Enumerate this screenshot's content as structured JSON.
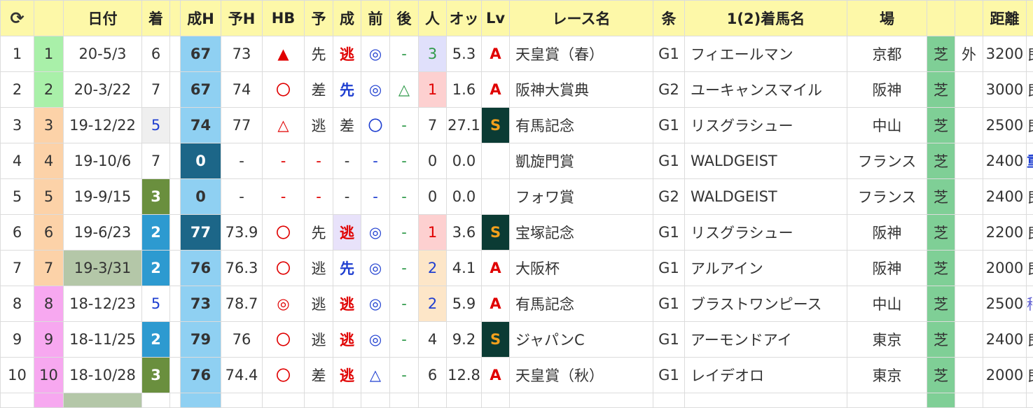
{
  "header": {
    "refresh_icon": "refresh-icon",
    "cols": [
      "",
      "日付",
      "着",
      "",
      "成H",
      "予H",
      "HB",
      "予",
      "成",
      "前",
      "後",
      "人",
      "オッ",
      "Lv",
      "レース名",
      "条",
      "1(2)着馬名",
      "場",
      "",
      "",
      "距離",
      ""
    ]
  },
  "rows": [
    {
      "idx": "1",
      "num": "1",
      "date": "20-5/3",
      "finish": "6",
      "seiH": "67",
      "yoH": "73",
      "hb": "▲",
      "yo": "先",
      "sei": "逃",
      "mae": "◎",
      "ato": "-",
      "pop": "3",
      "odds": "5.3",
      "lv": "A",
      "race": "天皇賞（春）",
      "cls": "G1",
      "horse": "フィエールマン",
      "venue": "京都",
      "surface": "芝",
      "course": "外",
      "dist": "3200",
      "going": "良"
    },
    {
      "idx": "2",
      "num": "2",
      "date": "20-3/22",
      "finish": "7",
      "seiH": "67",
      "yoH": "74",
      "hb": "〇",
      "yo": "差",
      "sei": "先",
      "mae": "◎",
      "ato": "△",
      "pop": "1",
      "odds": "1.6",
      "lv": "A",
      "race": "阪神大賞典",
      "cls": "G2",
      "horse": "ユーキャンスマイル",
      "venue": "阪神",
      "surface": "芝",
      "course": "",
      "dist": "3000",
      "going": "良"
    },
    {
      "idx": "3",
      "num": "3",
      "date": "19-12/22",
      "finish": "5",
      "seiH": "74",
      "yoH": "77",
      "hb": "△",
      "yo": "逃",
      "sei": "差",
      "mae": "〇",
      "ato": "-",
      "pop": "7",
      "odds": "27.1",
      "lv": "S",
      "race": "有馬記念",
      "cls": "G1",
      "horse": "リスグラシュー",
      "venue": "中山",
      "surface": "芝",
      "course": "",
      "dist": "2500",
      "going": "良"
    },
    {
      "idx": "4",
      "num": "4",
      "date": "19-10/6",
      "finish": "7",
      "seiH": "0",
      "yoH": "-",
      "hb": "-",
      "yo": "-",
      "sei": "-",
      "mae": "-",
      "ato": "-",
      "pop": "0",
      "odds": "0.0",
      "lv": "",
      "race": "凱旋門賞",
      "cls": "G1",
      "horse": "WALDGEIST",
      "venue": "フランス",
      "surface": "芝",
      "course": "",
      "dist": "2400",
      "going": "重"
    },
    {
      "idx": "5",
      "num": "5",
      "date": "19-9/15",
      "finish": "3",
      "seiH": "0",
      "yoH": "-",
      "hb": "-",
      "yo": "-",
      "sei": "-",
      "mae": "-",
      "ato": "-",
      "pop": "0",
      "odds": "0.0",
      "lv": "",
      "race": "フォワ賞",
      "cls": "G2",
      "horse": "WALDGEIST",
      "venue": "フランス",
      "surface": "芝",
      "course": "",
      "dist": "2400",
      "going": "良"
    },
    {
      "idx": "6",
      "num": "6",
      "date": "19-6/23",
      "finish": "2",
      "seiH": "77",
      "yoH": "73.9",
      "hb": "〇",
      "yo": "先",
      "sei": "逃",
      "mae": "◎",
      "ato": "-",
      "pop": "1",
      "odds": "3.6",
      "lv": "S",
      "race": "宝塚記念",
      "cls": "G1",
      "horse": "リスグラシュー",
      "venue": "阪神",
      "surface": "芝",
      "course": "",
      "dist": "2200",
      "going": "良"
    },
    {
      "idx": "7",
      "num": "7",
      "date": "19-3/31",
      "finish": "2",
      "seiH": "76",
      "yoH": "76.3",
      "hb": "〇",
      "yo": "逃",
      "sei": "先",
      "mae": "◎",
      "ato": "-",
      "pop": "2",
      "odds": "4.1",
      "lv": "A",
      "race": "大阪杯",
      "cls": "G1",
      "horse": "アルアイン",
      "venue": "阪神",
      "surface": "芝",
      "course": "",
      "dist": "2000",
      "going": "良"
    },
    {
      "idx": "8",
      "num": "8",
      "date": "18-12/23",
      "finish": "5",
      "seiH": "73",
      "yoH": "78.7",
      "hb": "◎",
      "yo": "逃",
      "sei": "逃",
      "mae": "◎",
      "ato": "-",
      "pop": "2",
      "odds": "5.9",
      "lv": "A",
      "race": "有馬記念",
      "cls": "G1",
      "horse": "ブラストワンピース",
      "venue": "中山",
      "surface": "芝",
      "course": "",
      "dist": "2500",
      "going": "稍"
    },
    {
      "idx": "9",
      "num": "9",
      "date": "18-11/25",
      "finish": "2",
      "seiH": "79",
      "yoH": "76",
      "hb": "〇",
      "yo": "逃",
      "sei": "逃",
      "mae": "◎",
      "ato": "-",
      "pop": "4",
      "odds": "9.2",
      "lv": "S",
      "race": "ジャパンC",
      "cls": "G1",
      "horse": "アーモンドアイ",
      "venue": "東京",
      "surface": "芝",
      "course": "",
      "dist": "2400",
      "going": "良"
    },
    {
      "idx": "10",
      "num": "10",
      "date": "18-10/28",
      "finish": "3",
      "seiH": "76",
      "yoH": "74.4",
      "hb": "〇",
      "yo": "差",
      "sei": "逃",
      "mae": "△",
      "ato": "-",
      "pop": "6",
      "odds": "12.8",
      "lv": "A",
      "race": "天皇賞（秋）",
      "cls": "G1",
      "horse": "レイデオロ",
      "venue": "東京",
      "surface": "芝",
      "course": "",
      "dist": "2000",
      "going": "良"
    }
  ],
  "colors": {
    "header_bg": "#fdf8a8",
    "num_green": "#a9f0a9",
    "num_orange": "#fcd2a8",
    "num_pink": "#f7a8f0",
    "seiH_light": "#8fd0f2",
    "seiH_dark": "#1c6688",
    "finish_1": "#2e8fc8",
    "finish_2": "#2d9ad0",
    "finish_3": "#6a8f3e",
    "surface_turf": "#7fcf96",
    "pop_1_bg": "#fdd0d0",
    "pop_2_bg": "#fde6c8",
    "pop_3_bg": "#e0e0fb",
    "sei_highlight": "#e8e2fa",
    "date_highlight": "#b4c7a8",
    "lv_S_bg": "#0b3b34"
  }
}
